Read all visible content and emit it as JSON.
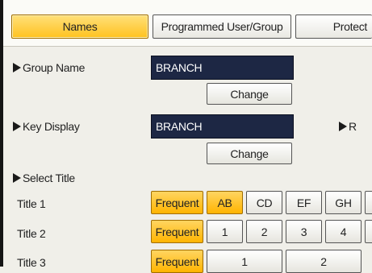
{
  "tabs": [
    {
      "label": "Names",
      "active": true
    },
    {
      "label": "Programmed User/Group",
      "active": false
    },
    {
      "label": "Protect",
      "active": false
    }
  ],
  "group_name": {
    "label": "Group Name",
    "value": "BRANCH",
    "change_label": "Change"
  },
  "key_display": {
    "label": "Key Display",
    "value": "BRANCH",
    "change_label": "Change",
    "right_label": "R"
  },
  "select_title": {
    "label": "Select Title",
    "titles": [
      {
        "label": "Title 1",
        "frequent": "Frequent",
        "keys": [
          "AB",
          "CD",
          "EF",
          "GH"
        ]
      },
      {
        "label": "Title 2",
        "frequent": "Frequent",
        "keys": [
          "1",
          "2",
          "3",
          "4"
        ]
      },
      {
        "label": "Title 3",
        "frequent": "Frequent",
        "keys": [
          "1",
          "2"
        ]
      }
    ]
  },
  "colors": {
    "accent": "#ffc21f",
    "field_bg": "#1d2744"
  }
}
